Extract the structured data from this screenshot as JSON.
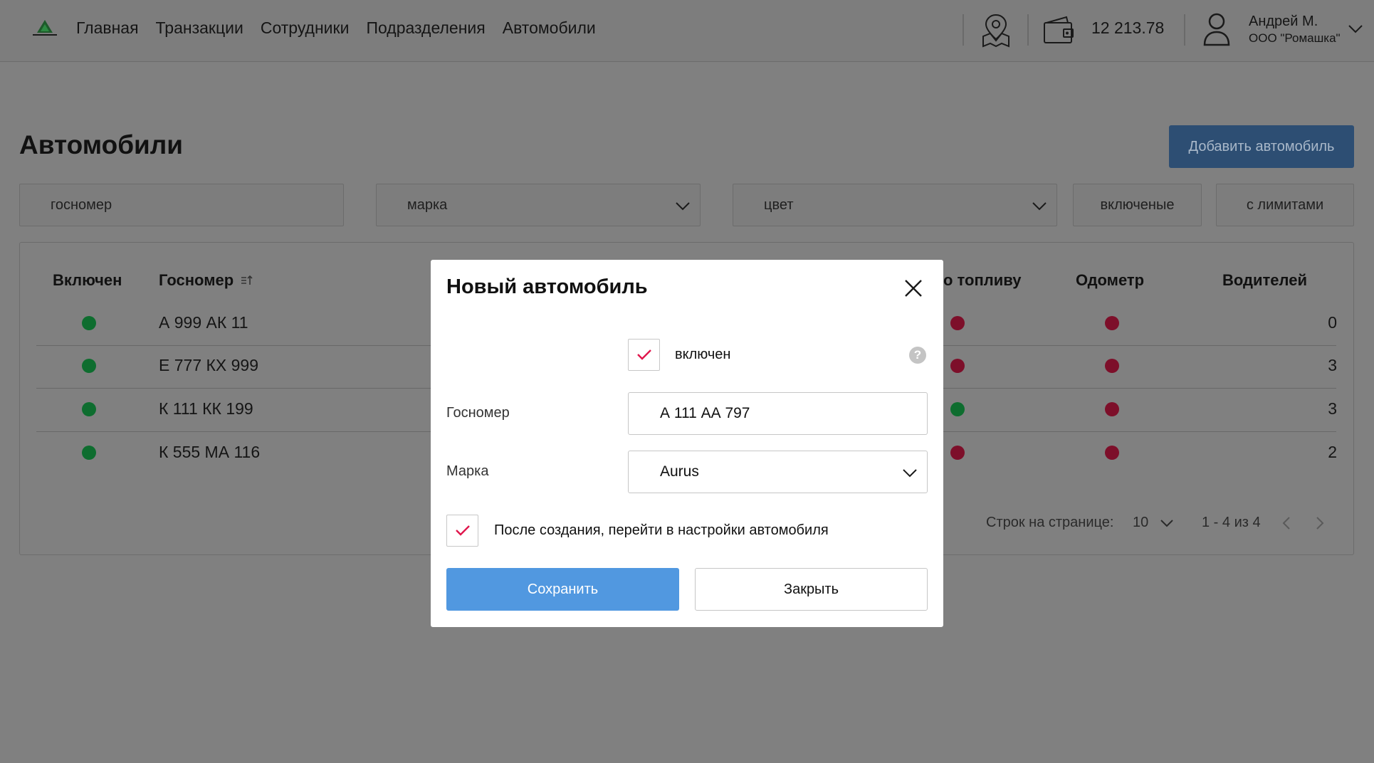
{
  "header": {
    "nav": [
      "Главная",
      "Транзакции",
      "Сотрудники",
      "Подразделения",
      "Автомобили"
    ],
    "balance": "12 213.78",
    "user": {
      "name": "Андрей М.",
      "org": "ООО \"Ромашка\""
    }
  },
  "page": {
    "title": "Автомобили",
    "add_button": "Добавить автомобиль",
    "filters": {
      "plate_placeholder": "госномер",
      "brand_placeholder": "марка",
      "color_placeholder": "цвет",
      "enabled_button": "включеные",
      "limits_button": "с лимитами"
    }
  },
  "table": {
    "columns": {
      "enabled": "Включен",
      "plate": "Госномер",
      "fuel": "о топливу",
      "odometer": "Одометр",
      "drivers": "Водителей"
    },
    "rows": [
      {
        "enabled": "green",
        "plate": "А 999 АК 11",
        "fuel": "red",
        "odometer": "red",
        "drivers": "0"
      },
      {
        "enabled": "green",
        "plate": "Е 777 КХ 999",
        "fuel": "red",
        "odometer": "red",
        "drivers": "3"
      },
      {
        "enabled": "green",
        "plate": "К 111 КК 199",
        "fuel": "green",
        "odometer": "red",
        "drivers": "3"
      },
      {
        "enabled": "green",
        "plate": "К 555 МА 116",
        "fuel": "red",
        "odometer": "red",
        "drivers": "2"
      }
    ],
    "pagination": {
      "rows_per_page_label": "Строк на странице:",
      "rows_per_page": "10",
      "range": "1 - 4 из 4"
    }
  },
  "modal": {
    "title": "Новый автомобиль",
    "enabled_label": "включен",
    "plate_label": "Госномер",
    "plate_value": "А 111 АА 797",
    "brand_label": "Марка",
    "brand_value": "Aurus",
    "goto_settings_label": "После создания, перейти в настройки автомобиля",
    "save": "Сохранить",
    "close": "Закрыть",
    "help_glyph": "?"
  },
  "colors": {
    "status_green": "#0e6d2f",
    "status_red": "#7d0f2a",
    "primary": "#5198e0",
    "check": "#e0174d"
  },
  "icons": [
    "logo-icon",
    "map-pin-icon",
    "wallet-icon",
    "user-icon",
    "chevron-down-icon",
    "sort-icon",
    "close-icon",
    "check-icon",
    "help-icon",
    "chevron-left-icon",
    "chevron-right-icon"
  ]
}
